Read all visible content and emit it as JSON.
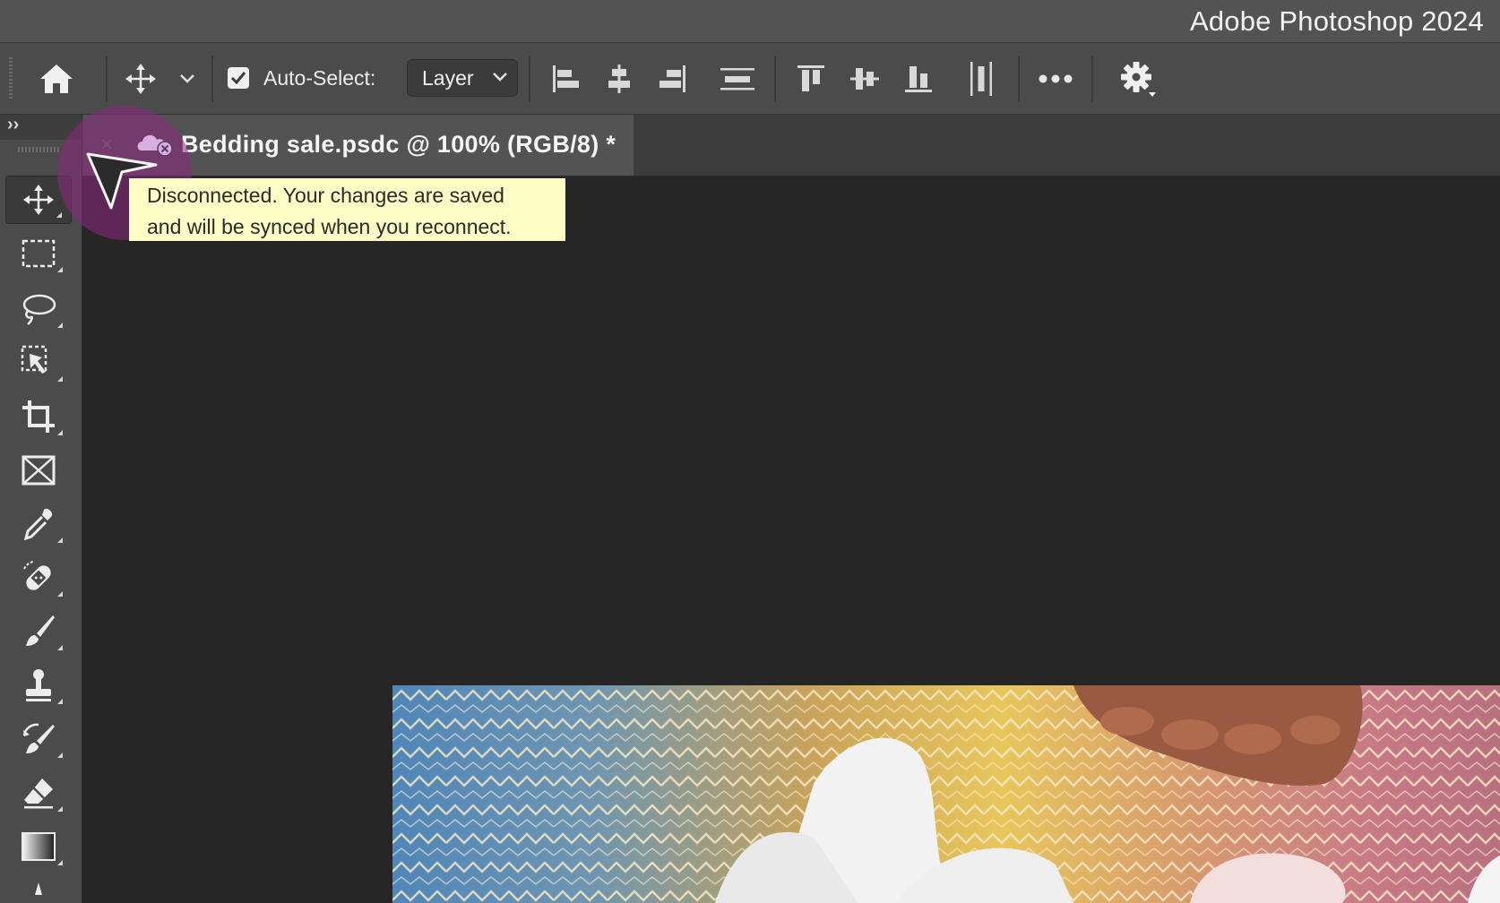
{
  "app": {
    "title": "Adobe Photoshop 2024"
  },
  "options_bar": {
    "auto_select_label": "Auto-Select:",
    "auto_select_checked": true,
    "auto_select_target": "Layer",
    "more_label": "•••"
  },
  "document_tab": {
    "title": "Bedding sale.psdc @ 100% (RGB/8) *",
    "close_glyph": "×"
  },
  "toolbar": {
    "expand_glyph": "››",
    "tools": [
      "move-tool",
      "rectangular-marquee-tool",
      "lasso-tool",
      "object-selection-tool",
      "crop-tool",
      "frame-tool",
      "eyedropper-tool",
      "spot-healing-brush-tool",
      "brush-tool",
      "clone-stamp-tool",
      "history-brush-tool",
      "eraser-tool",
      "gradient-tool"
    ]
  },
  "tooltip": {
    "line1": "Disconnected. Your changes are saved",
    "line2": "and will be synced when you reconnect."
  },
  "colors": {
    "titlebar": "#535353",
    "panel": "#4b4b4b",
    "canvas": "#262626",
    "tooltip_bg": "#fdfdc6",
    "cursor_highlight": "#8c2882"
  }
}
